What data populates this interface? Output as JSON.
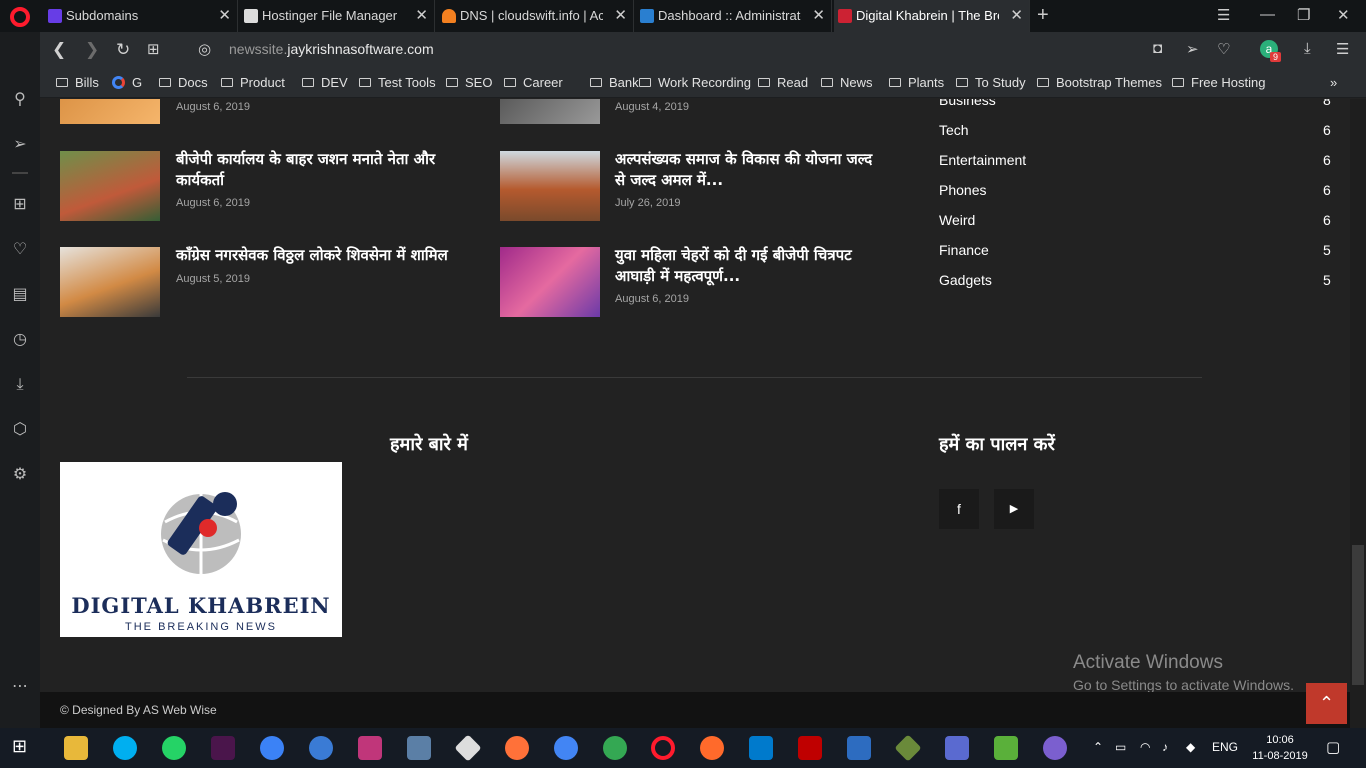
{
  "tabs": [
    {
      "title": "Subdomains",
      "color": "#673de6"
    },
    {
      "title": "Hostinger File Manager",
      "color": "#dcdcdc"
    },
    {
      "title": "DNS | cloudswift.info | Acco",
      "color": "#f38020"
    },
    {
      "title": "Dashboard :: Administrator",
      "color": "#2a7fd0"
    },
    {
      "title": "Digital Khabrein | The Break",
      "color": "#cc2233"
    }
  ],
  "address": {
    "prefix": "newssite.",
    "domain": "jaykrishnasoftware.com"
  },
  "bookmarks": [
    "Bills",
    "G",
    "Docs",
    "Product",
    "DEV",
    "Test Tools",
    "SEO",
    "Career",
    "Bank",
    "Work Recording",
    "Read",
    "News",
    "Plants",
    "To Study",
    "Bootstrap Themes",
    "Free Hosting"
  ],
  "articles": [
    {
      "title": "",
      "date": "August 6, 2019"
    },
    {
      "title": "",
      "date": "August 4, 2019"
    },
    {
      "title": "बीजेपी कार्यालय के बाहर जशन मनाते नेता और कार्यकर्ता",
      "date": "August 6, 2019"
    },
    {
      "title": "अल्पसंख्यक समाज के विकास की योजना जल्द से जल्द अमल में...",
      "date": "July 26, 2019"
    },
    {
      "title": "काँग्रेस नगरसेवक विठ्ठल लोकरे  शिवसेना में शामिल",
      "date": "August 5, 2019"
    },
    {
      "title": "युवा महिला चेहरों को दी गई बीजेपी चित्रपट आघाड़ी में महत्वपूर्ण...",
      "date": "August 6, 2019"
    }
  ],
  "categories": [
    {
      "name": "Business",
      "count": "8"
    },
    {
      "name": "Tech",
      "count": "6"
    },
    {
      "name": "Entertainment",
      "count": "6"
    },
    {
      "name": "Phones",
      "count": "6"
    },
    {
      "name": "Weird",
      "count": "6"
    },
    {
      "name": "Finance",
      "count": "5"
    },
    {
      "name": "Gadgets",
      "count": "5"
    }
  ],
  "about_title": "हमारे बारे में",
  "follow_title": "हमें का पालन करें",
  "logo": {
    "line1": "DIGITAL KHABREIN",
    "line2": "THE BREAKING NEWS"
  },
  "footer": "© Designed By AS Web Wise",
  "watermark": {
    "line1": "Activate Windows",
    "line2": "Go to Settings to activate Windows."
  },
  "badge_count": "9",
  "tray": {
    "lang": "ENG",
    "time": "10:06",
    "date": "11-08-2019"
  }
}
